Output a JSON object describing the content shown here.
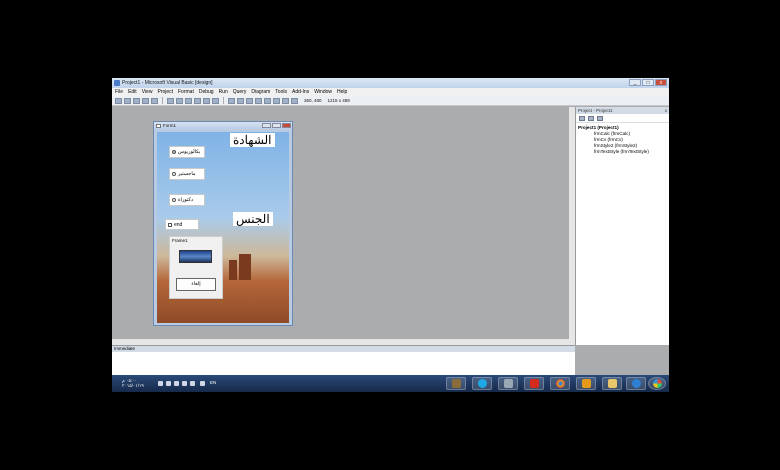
{
  "window": {
    "title": "Project1 - Microsoft Visual Basic [design]",
    "buttons": [
      "_",
      "□",
      "x"
    ]
  },
  "menu": [
    "File",
    "Edit",
    "View",
    "Project",
    "Format",
    "Debug",
    "Run",
    "Query",
    "Diagram",
    "Tools",
    "Add-Ins",
    "Window",
    "Help"
  ],
  "toolbar": {
    "position": "360, 480",
    "size": "1215 x 489"
  },
  "form": {
    "title": "Form1",
    "labels": {
      "certificate": "الشهادة",
      "gender": "الجنس"
    },
    "options": [
      {
        "label": "بكالوريوس",
        "selected": true
      },
      {
        "label": "ماجستير",
        "selected": false
      },
      {
        "label": "دكتوراة",
        "selected": false
      }
    ],
    "checkbox_label": "end",
    "frame_caption": "Frame1",
    "command_label": "إلغاء"
  },
  "project_panel": {
    "title": "Project - Project1",
    "close": "x",
    "root": "Project1 (Project1)",
    "items": [
      "frmCalc (frmCalc)",
      "frmCv (frmCv)",
      "frmStyle2 (frmStyle2)",
      "frmTextStyle (frmTextStyle)"
    ]
  },
  "immediate": {
    "title": "Immediate"
  },
  "taskbar": {
    "time": "٠٥:٠٠ م",
    "date": "٢٠١٥/٠١/١٩",
    "language": "EN"
  }
}
